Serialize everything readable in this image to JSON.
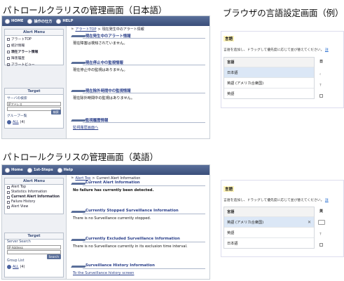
{
  "captions": {
    "ja_admin": "パトロールクラリスの管理画面（日本語）",
    "browser_settings": "ブラウザの言語設定画面（例）",
    "en_admin": "パトロールクラリスの管理画面（英語）"
  },
  "ja_admin": {
    "topbar": [
      "HOME",
      "操作の仕方",
      "HELP"
    ],
    "sidebar": {
      "menu_title": "Alert Menu",
      "items": [
        "アラートTOP",
        "統計情報",
        "現在アラート情報",
        "障害履歴",
        "アラートビュー"
      ],
      "target_title": "Target",
      "server_label": "サーバの検索",
      "select_value": "IPアドレス",
      "search_button": "検索",
      "group_label": "グループ一覧",
      "group_link": "ALL",
      "group_count": "(4)"
    },
    "breadcrumb": {
      "link": "アラートTOP",
      "current": "現在発生中のアラート情報"
    },
    "sections": [
      {
        "title": "現在発生中のアラート情報",
        "body": "現在障害は検知されていません。"
      },
      {
        "title": "現在停止中の監視情報",
        "body": "現在停止中の監視はありません。"
      },
      {
        "title": "現在除外時間中の監視情報",
        "body": "現在除外時間中の監視はありません。"
      },
      {
        "title": "監視履歴情報",
        "body": "監視履歴画面へ"
      }
    ]
  },
  "en_admin": {
    "topbar": [
      "Home",
      "1st-Steps",
      "Help"
    ],
    "sidebar": {
      "menu_title": "Alert Menu",
      "items": [
        "Alert Top",
        "Statistics Information",
        "Current Alert Information",
        "Failure History",
        "Alert View"
      ],
      "target_title": "Target",
      "server_label": "Server Search",
      "select_value": "IP Address",
      "search_button": "Search",
      "group_label": "Group List",
      "group_link": "ALL",
      "group_count": "(4)"
    },
    "breadcrumb": {
      "link": "Alert Top",
      "current": "Current Alert Information"
    },
    "sections": [
      {
        "title": "Current Alert Information",
        "body": "No failure has currently been detected."
      },
      {
        "title": "Currently Stopped Surveillance Information",
        "body": "There is no Surveillance currently stopped."
      },
      {
        "title": "Currently Excluded Surveillance Information",
        "body": "There is no Surveillance currently in its exclusion time interval."
      },
      {
        "title": "Surveillance History Information",
        "body": "To the Surveillance history screen"
      }
    ]
  },
  "browser_ja": {
    "title": "言語",
    "description": "言語を追加し、ドラッグして優先度に応じて並び替えてください。",
    "description_link": "詳",
    "table_header": "言語",
    "side_header": "日",
    "rows": [
      "日本語",
      "英語 (アメリカ合衆国)",
      "英語"
    ]
  },
  "browser_en": {
    "title": "言語",
    "description": "言語を追加し、ドラッグして優先度に応じて並び替えてください。",
    "description_link": "詳",
    "table_header": "言語",
    "side_header": "英",
    "rows": [
      "英語 (アメリカ合衆国)",
      "英語",
      "日本語"
    ]
  }
}
